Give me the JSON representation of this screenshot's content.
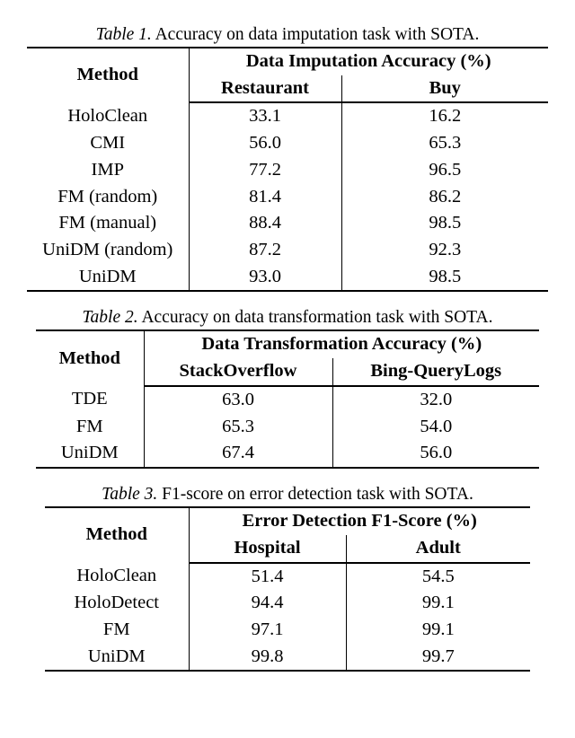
{
  "tables": [
    {
      "caption_prefix": "Table 1.",
      "caption_rest": " Accuracy on data imputation task with SOTA.",
      "method_label": "Method",
      "accuracy_label": "Data Imputation Accuracy (%)",
      "col1": "Restaurant",
      "col2": "Buy",
      "widths": {
        "m": 180,
        "c1": 170,
        "c2": 230
      },
      "rows": [
        {
          "m": "HoloClean",
          "v1": "33.1",
          "v2": "16.2"
        },
        {
          "m": "CMI",
          "v1": "56.0",
          "v2": "65.3"
        },
        {
          "m": "IMP",
          "v1": "77.2",
          "v2": "96.5"
        },
        {
          "m": "FM (random)",
          "v1": "81.4",
          "v2": "86.2"
        },
        {
          "m": "FM (manual)",
          "v1": "88.4",
          "v2": "98.5"
        },
        {
          "m": "UniDM (random)",
          "v1": "87.2",
          "v2": "92.3"
        },
        {
          "m": "UniDM",
          "v1": "93.0",
          "v2": "98.5"
        }
      ]
    },
    {
      "caption_prefix": "Table 2.",
      "caption_rest": " Accuracy on data transformation task with SOTA.",
      "method_label": "Method",
      "accuracy_label": "Data Transformation Accuracy (%)",
      "col1": "StackOverflow",
      "col2": "Bing-QueryLogs",
      "widths": {
        "m": 120,
        "c1": 210,
        "c2": 230
      },
      "rows": [
        {
          "m": "TDE",
          "v1": "63.0",
          "v2": "32.0"
        },
        {
          "m": "FM",
          "v1": "65.3",
          "v2": "54.0"
        },
        {
          "m": "UniDM",
          "v1": "67.4",
          "v2": "56.0"
        }
      ]
    },
    {
      "caption_prefix": "Table 3.",
      "caption_rest": " F1-score on error detection task with SOTA.",
      "method_label": "Method",
      "accuracy_label": "Error Detection F1-Score (%)",
      "col1": "Hospital",
      "col2": "Adult",
      "widths": {
        "m": 160,
        "c1": 175,
        "c2": 205
      },
      "rows": [
        {
          "m": "HoloClean",
          "v1": "51.4",
          "v2": "54.5"
        },
        {
          "m": "HoloDetect",
          "v1": "94.4",
          "v2": "99.1"
        },
        {
          "m": "FM",
          "v1": "97.1",
          "v2": "99.1"
        },
        {
          "m": "UniDM",
          "v1": "99.8",
          "v2": "99.7"
        }
      ]
    }
  ],
  "chart_data": [
    {
      "type": "table",
      "title": "Accuracy on data imputation task with SOTA.",
      "columns": [
        "Method",
        "Restaurant",
        "Buy"
      ],
      "rows": [
        [
          "HoloClean",
          33.1,
          16.2
        ],
        [
          "CMI",
          56.0,
          65.3
        ],
        [
          "IMP",
          77.2,
          96.5
        ],
        [
          "FM (random)",
          81.4,
          86.2
        ],
        [
          "FM (manual)",
          88.4,
          98.5
        ],
        [
          "UniDM (random)",
          87.2,
          92.3
        ],
        [
          "UniDM",
          93.0,
          98.5
        ]
      ]
    },
    {
      "type": "table",
      "title": "Accuracy on data transformation task with SOTA.",
      "columns": [
        "Method",
        "StackOverflow",
        "Bing-QueryLogs"
      ],
      "rows": [
        [
          "TDE",
          63.0,
          32.0
        ],
        [
          "FM",
          65.3,
          54.0
        ],
        [
          "UniDM",
          67.4,
          56.0
        ]
      ]
    },
    {
      "type": "table",
      "title": "F1-score on error detection task with SOTA.",
      "columns": [
        "Method",
        "Hospital",
        "Adult"
      ],
      "rows": [
        [
          "HoloClean",
          51.4,
          54.5
        ],
        [
          "HoloDetect",
          94.4,
          99.1
        ],
        [
          "FM",
          97.1,
          99.1
        ],
        [
          "UniDM",
          99.8,
          99.7
        ]
      ]
    }
  ]
}
